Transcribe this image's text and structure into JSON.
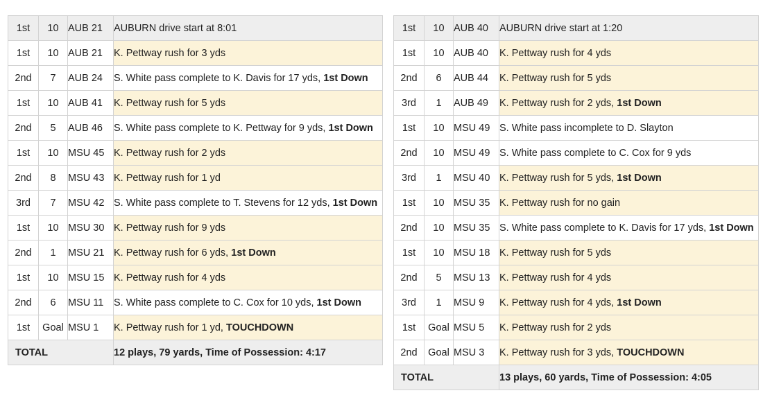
{
  "drives": [
    {
      "header": {
        "down": "1st",
        "dist": "10",
        "spot": "AUB 21",
        "text": "AUBURN drive start at 8:01"
      },
      "plays": [
        {
          "down": "1st",
          "dist": "10",
          "spot": "AUB 21",
          "text": "K. Pettway rush for 3 yds",
          "emph": "",
          "kind": "rush"
        },
        {
          "down": "2nd",
          "dist": "7",
          "spot": "AUB 24",
          "text": "S. White pass complete to K. Davis for 17 yds, ",
          "emph": "1st Down",
          "kind": "pass"
        },
        {
          "down": "1st",
          "dist": "10",
          "spot": "AUB 41",
          "text": "K. Pettway rush for 5 yds",
          "emph": "",
          "kind": "rush"
        },
        {
          "down": "2nd",
          "dist": "5",
          "spot": "AUB 46",
          "text": "S. White pass complete to K. Pettway for 9 yds, ",
          "emph": "1st Down",
          "kind": "pass"
        },
        {
          "down": "1st",
          "dist": "10",
          "spot": "MSU 45",
          "text": "K. Pettway rush for 2 yds",
          "emph": "",
          "kind": "rush"
        },
        {
          "down": "2nd",
          "dist": "8",
          "spot": "MSU 43",
          "text": "K. Pettway rush for 1 yd",
          "emph": "",
          "kind": "rush"
        },
        {
          "down": "3rd",
          "dist": "7",
          "spot": "MSU 42",
          "text": "S. White pass complete to T. Stevens for 12 yds, ",
          "emph": "1st Down",
          "kind": "pass"
        },
        {
          "down": "1st",
          "dist": "10",
          "spot": "MSU 30",
          "text": "K. Pettway rush for 9 yds",
          "emph": "",
          "kind": "rush"
        },
        {
          "down": "2nd",
          "dist": "1",
          "spot": "MSU 21",
          "text": "K. Pettway rush for 6 yds, ",
          "emph": "1st Down",
          "kind": "rush"
        },
        {
          "down": "1st",
          "dist": "10",
          "spot": "MSU 15",
          "text": "K. Pettway rush for 4 yds",
          "emph": "",
          "kind": "rush"
        },
        {
          "down": "2nd",
          "dist": "6",
          "spot": "MSU 11",
          "text": "S. White pass complete to C. Cox for 10 yds, ",
          "emph": "1st Down",
          "kind": "pass"
        },
        {
          "down": "1st",
          "dist": "Goal",
          "spot": "MSU 1",
          "text": "K. Pettway rush for 1 yd, ",
          "emph": "TOUCHDOWN",
          "kind": "rush"
        }
      ],
      "total": {
        "label": "TOTAL",
        "text": "12 plays, 79 yards, Time of Possession: 4:17"
      }
    },
    {
      "header": {
        "down": "1st",
        "dist": "10",
        "spot": "AUB 40",
        "text": "AUBURN drive start at 1:20"
      },
      "plays": [
        {
          "down": "1st",
          "dist": "10",
          "spot": "AUB 40",
          "text": "K. Pettway rush for 4 yds",
          "emph": "",
          "kind": "rush"
        },
        {
          "down": "2nd",
          "dist": "6",
          "spot": "AUB 44",
          "text": "K. Pettway rush for 5 yds",
          "emph": "",
          "kind": "rush"
        },
        {
          "down": "3rd",
          "dist": "1",
          "spot": "AUB 49",
          "text": "K. Pettway rush for 2 yds, ",
          "emph": "1st Down",
          "kind": "rush"
        },
        {
          "down": "1st",
          "dist": "10",
          "spot": "MSU 49",
          "text": "S. White pass incomplete to D. Slayton",
          "emph": "",
          "kind": "pass"
        },
        {
          "down": "2nd",
          "dist": "10",
          "spot": "MSU 49",
          "text": "S. White pass complete to C. Cox for 9 yds",
          "emph": "",
          "kind": "pass"
        },
        {
          "down": "3rd",
          "dist": "1",
          "spot": "MSU 40",
          "text": "K. Pettway rush for 5 yds, ",
          "emph": "1st Down",
          "kind": "rush"
        },
        {
          "down": "1st",
          "dist": "10",
          "spot": "MSU 35",
          "text": "K. Pettway rush for no gain",
          "emph": "",
          "kind": "rush"
        },
        {
          "down": "2nd",
          "dist": "10",
          "spot": "MSU 35",
          "text": "S. White pass complete to K. Davis for 17 yds, ",
          "emph": "1st Down",
          "kind": "pass"
        },
        {
          "down": "1st",
          "dist": "10",
          "spot": "MSU 18",
          "text": "K. Pettway rush for 5 yds",
          "emph": "",
          "kind": "rush"
        },
        {
          "down": "2nd",
          "dist": "5",
          "spot": "MSU 13",
          "text": "K. Pettway rush for 4 yds",
          "emph": "",
          "kind": "rush"
        },
        {
          "down": "3rd",
          "dist": "1",
          "spot": "MSU 9",
          "text": "K. Pettway rush for 4 yds, ",
          "emph": "1st Down",
          "kind": "rush"
        },
        {
          "down": "1st",
          "dist": "Goal",
          "spot": "MSU 5",
          "text": "K. Pettway rush for 2 yds",
          "emph": "",
          "kind": "rush"
        },
        {
          "down": "2nd",
          "dist": "Goal",
          "spot": "MSU 3",
          "text": "K. Pettway rush for 3 yds, ",
          "emph": "TOUCHDOWN",
          "kind": "rush"
        }
      ],
      "total": {
        "label": "TOTAL",
        "text": "13 plays, 60 yards, Time of Possession: 4:05"
      }
    }
  ]
}
